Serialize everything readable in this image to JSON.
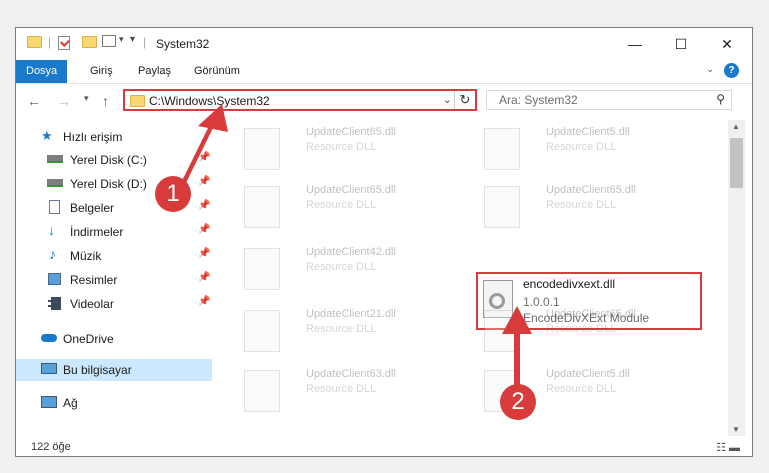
{
  "window": {
    "title": "System32",
    "controls": [
      "minimize-icon",
      "maximize-icon",
      "close-icon"
    ]
  },
  "ribbon": {
    "tabs": [
      {
        "label": "Dosya",
        "active": true
      },
      {
        "label": "Giriş"
      },
      {
        "label": "Paylaş"
      },
      {
        "label": "Görünüm"
      }
    ]
  },
  "nav": {
    "address": "C:\\Windows\\System32",
    "search_placeholder": "Ara: System32"
  },
  "sidebar": {
    "items": [
      {
        "label": "Hızlı erişim",
        "icon": "star-icon"
      },
      {
        "label": "Yerel Disk (C:)",
        "icon": "drive-icon",
        "pinned": true
      },
      {
        "label": "Yerel Disk (D:)",
        "icon": "drive-icon",
        "pinned": true
      },
      {
        "label": "Belgeler",
        "icon": "documents-icon",
        "pinned": true
      },
      {
        "label": "İndirmeler",
        "icon": "download-icon",
        "pinned": true
      },
      {
        "label": "Müzik",
        "icon": "music-icon",
        "pinned": true
      },
      {
        "label": "Resimler",
        "icon": "pictures-icon",
        "pinned": true
      },
      {
        "label": "Videolar",
        "icon": "videos-icon",
        "pinned": true
      },
      {
        "label": "OneDrive",
        "icon": "cloud-icon"
      },
      {
        "label": "Bu bilgisayar",
        "icon": "computer-icon",
        "selected": true
      },
      {
        "label": "Ağ",
        "icon": "network-icon"
      }
    ]
  },
  "files": [
    {
      "name": "UpdateClient65.dll",
      "desc": "Resource DLL"
    },
    {
      "name": "UpdateClient5.dll",
      "desc": "Resource DLL"
    },
    {
      "name": "UpdateClient65.dll",
      "desc": "Resource DLL"
    },
    {
      "name": "UpdateClient65.dll",
      "desc": "Resource DLL"
    },
    {
      "name": "UpdateClient42.dll",
      "desc": "Resource DLL"
    },
    {
      "name": "encodedivxext.dll",
      "version": "1.0.0.1",
      "desc": "EncodeDivXExt Module",
      "highlighted": true
    },
    {
      "name": "UpdateClient21.dll",
      "desc": "Resource DLL"
    },
    {
      "name": "UpdateClient65.dll",
      "desc": "Resource DLL"
    },
    {
      "name": "UpdateClient63.dll",
      "desc": "Resource DLL"
    },
    {
      "name": "UpdateClient5.dll",
      "desc": "Resource DLL"
    }
  ],
  "status": {
    "count": "122 öğe"
  },
  "annotations": {
    "step1": "1",
    "step2": "2"
  },
  "colors": {
    "accent": "#1979ca",
    "highlight": "#d83b3b",
    "selection": "#cce8ff"
  }
}
